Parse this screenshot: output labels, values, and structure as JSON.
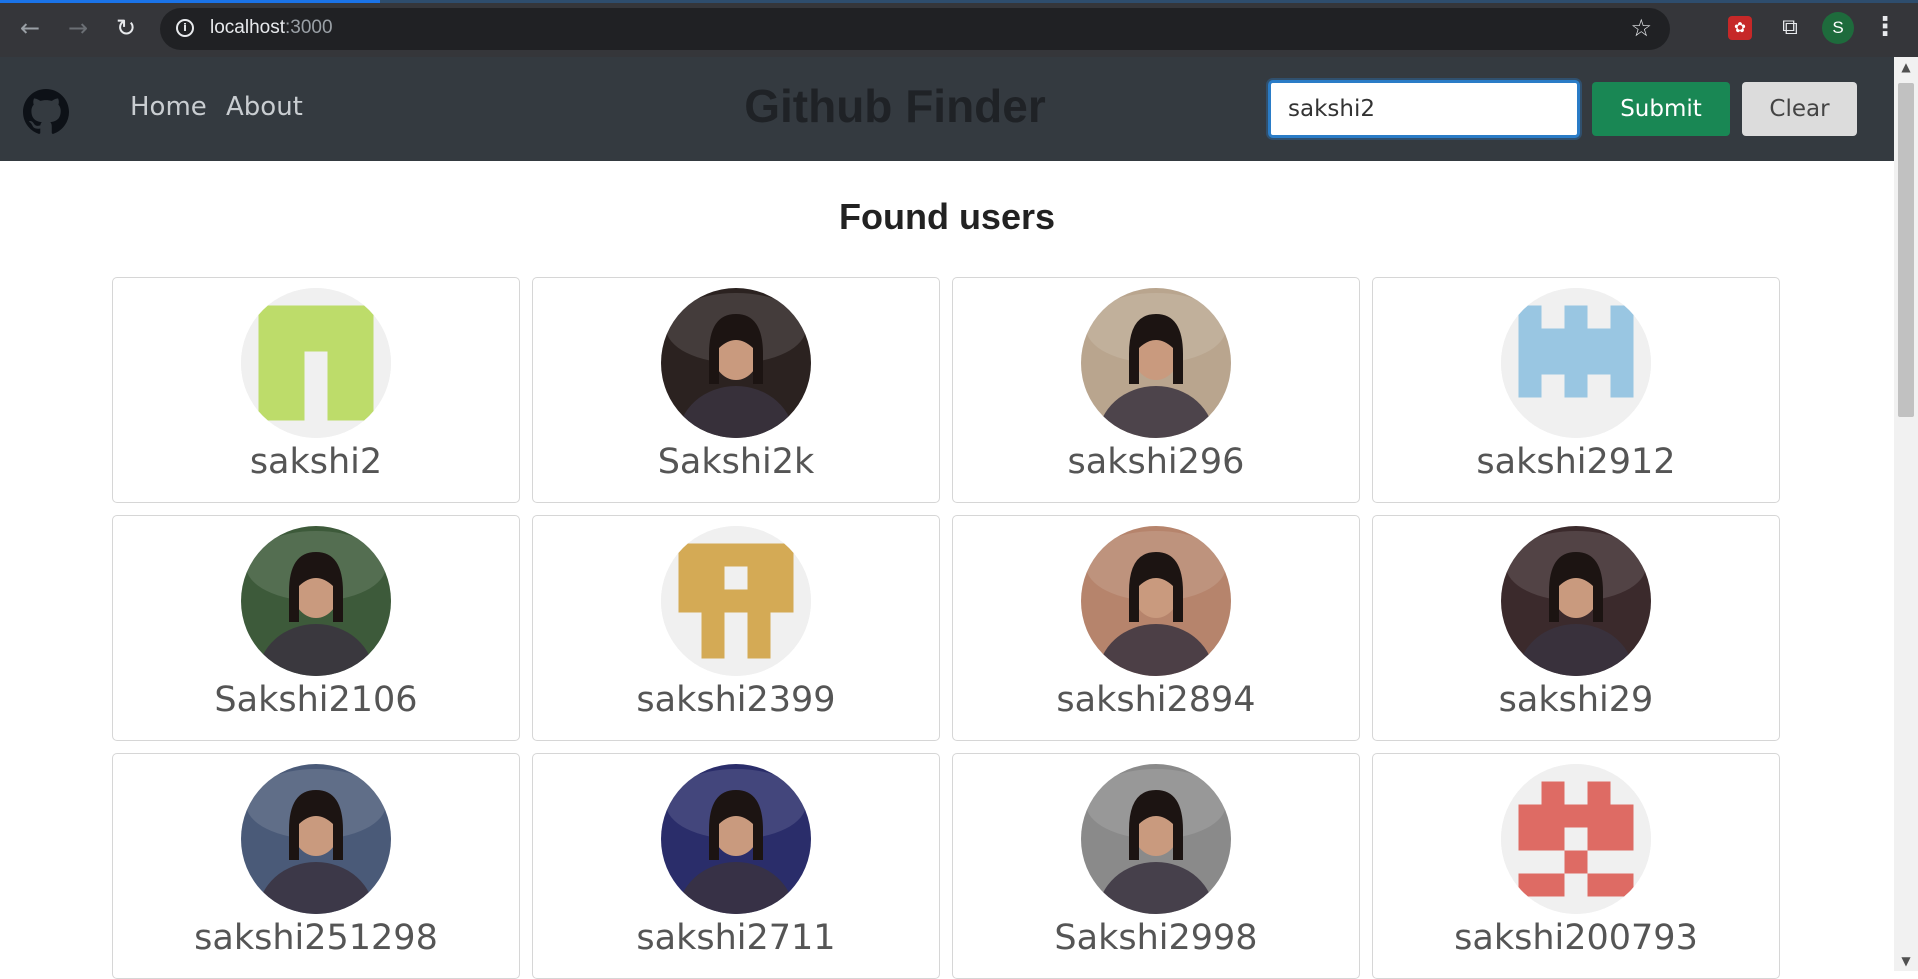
{
  "browser": {
    "url_host": "localhost",
    "url_port": ":3000",
    "profile_initial": "S",
    "icons": {
      "back": "←",
      "forward": "→",
      "reload": "↻",
      "info": "i",
      "star": "☆",
      "extension": "✿",
      "puzzle": "⧉",
      "menu": "⋮"
    }
  },
  "navbar": {
    "links": [
      "Home",
      "About"
    ],
    "brand": "Github Finder",
    "search_value": "sakshi2",
    "submit_label": "Submit",
    "clear_label": "Clear"
  },
  "heading": "Found users",
  "users": [
    {
      "login": "sakshi2",
      "avatar": "identicon",
      "color": "#bddc6a"
    },
    {
      "login": "Sakshi2k",
      "avatar": "photo",
      "color": "#2b2220"
    },
    {
      "login": "sakshi296",
      "avatar": "photo",
      "color": "#b9a58e"
    },
    {
      "login": "sakshi2912",
      "avatar": "identicon",
      "color": "#99c6e2"
    },
    {
      "login": "Sakshi2106",
      "avatar": "photo",
      "color": "#3d5a3a"
    },
    {
      "login": "sakshi2399",
      "avatar": "identicon",
      "color": "#d4aa55"
    },
    {
      "login": "sakshi2894",
      "avatar": "photo",
      "color": "#b6846c"
    },
    {
      "login": "sakshi29",
      "avatar": "photo",
      "color": "#3b2a2c"
    },
    {
      "login": "sakshi251298",
      "avatar": "photo",
      "color": "#4a5a78"
    },
    {
      "login": "sakshi2711",
      "avatar": "photo",
      "color": "#2a2d6a"
    },
    {
      "login": "Sakshi2998",
      "avatar": "photo",
      "color": "#8a8a8a"
    },
    {
      "login": "sakshi200793",
      "avatar": "identicon",
      "color": "#de6b64"
    }
  ]
}
